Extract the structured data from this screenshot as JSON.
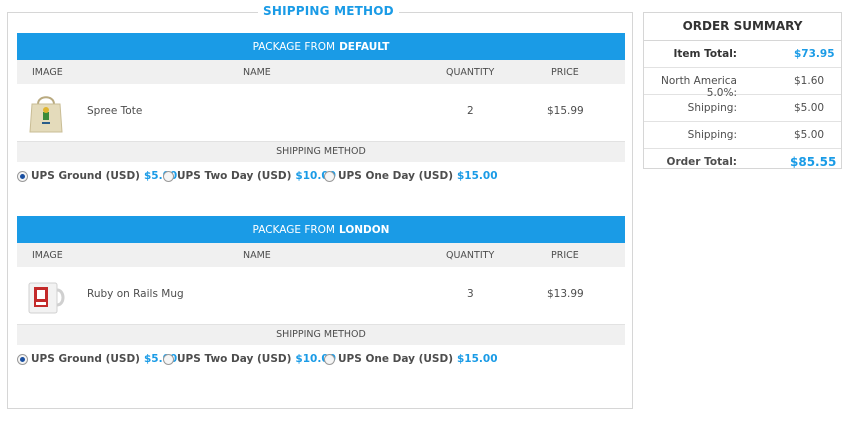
{
  "shipping": {
    "legend": "SHIPPING METHOD",
    "columns": {
      "image": "IMAGE",
      "name": "NAME",
      "quantity": "QUANTITY",
      "price": "PRICE"
    },
    "shipping_method_label": "SHIPPING METHOD",
    "packages": [
      {
        "prefix": "PACKAGE FROM",
        "location": "DEFAULT",
        "item": {
          "name": "Spree Tote",
          "quantity": "2",
          "price": "$15.99",
          "thumbnail": "tote-bag"
        },
        "rates": [
          {
            "label": "UPS Ground (USD)",
            "cost": "$5.00",
            "selected": true
          },
          {
            "label": "UPS Two Day (USD)",
            "cost": "$10.00",
            "selected": false
          },
          {
            "label": "UPS One Day (USD)",
            "cost": "$15.00",
            "selected": false
          }
        ]
      },
      {
        "prefix": "PACKAGE FROM",
        "location": "LONDON",
        "item": {
          "name": "Ruby on Rails Mug",
          "quantity": "3",
          "price": "$13.99",
          "thumbnail": "mug"
        },
        "rates": [
          {
            "label": "UPS Ground (USD)",
            "cost": "$5.00",
            "selected": true
          },
          {
            "label": "UPS Two Day (USD)",
            "cost": "$10.00",
            "selected": false
          },
          {
            "label": "UPS One Day (USD)",
            "cost": "$15.00",
            "selected": false
          }
        ]
      }
    ]
  },
  "summary": {
    "title": "ORDER SUMMARY",
    "item_total_label": "Item Total:",
    "item_total_value": "$73.95",
    "tax_label": "North America 5.0%:",
    "tax_value": "$1.60",
    "shipping1_label": "Shipping:",
    "shipping1_value": "$5.00",
    "shipping2_label": "Shipping:",
    "shipping2_value": "$5.00",
    "order_total_label": "Order Total:",
    "order_total_value": "$85.55"
  },
  "colors": {
    "accent": "#1a9be6",
    "header_bg": "#f0f0f0",
    "border": "#d6d6d6"
  }
}
